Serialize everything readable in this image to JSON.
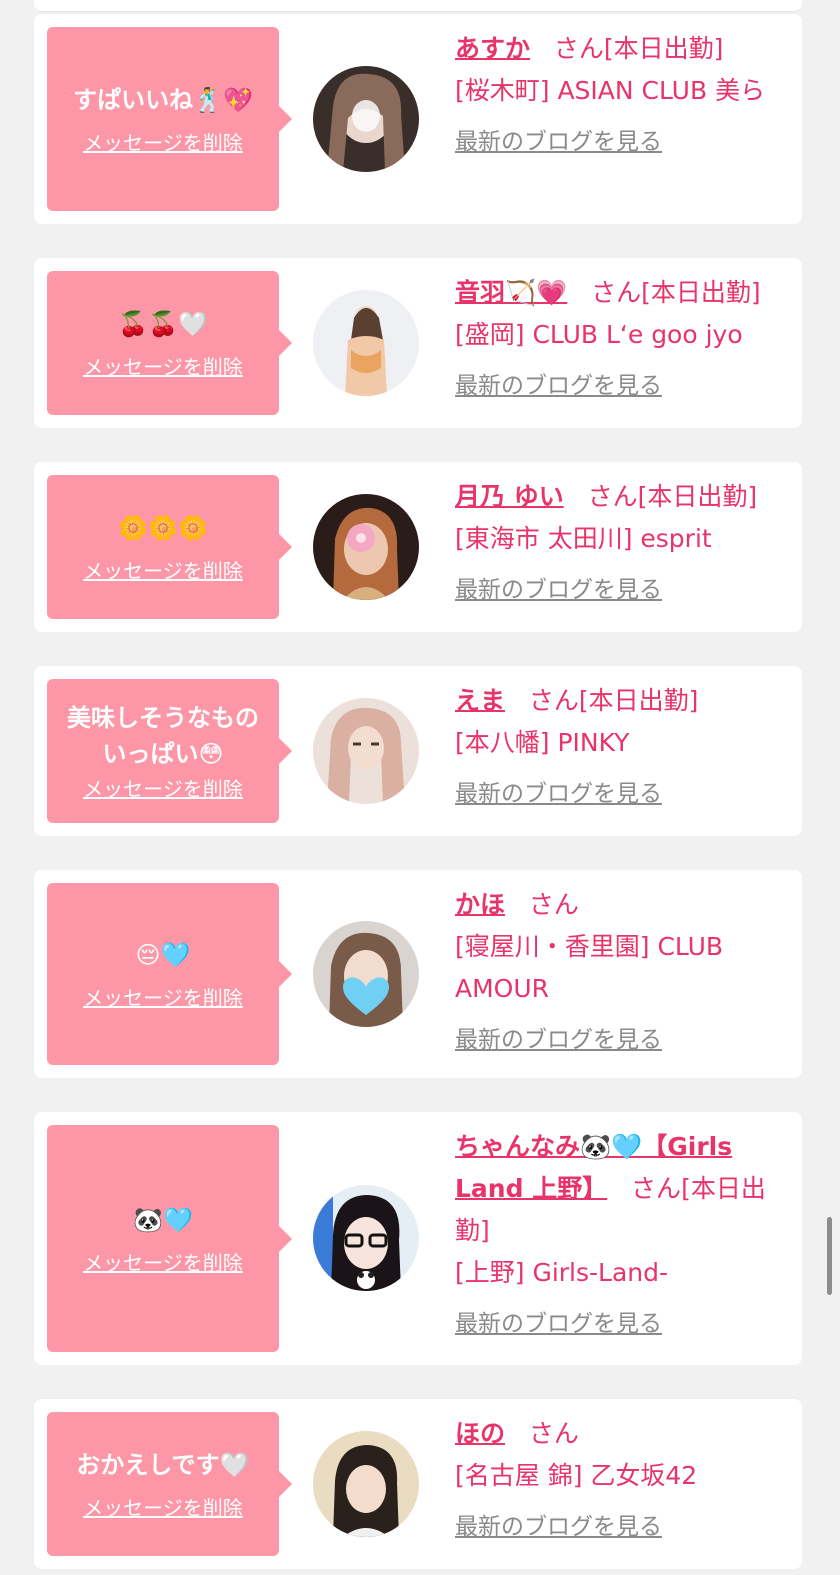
{
  "san_label": "さん",
  "delete_label": "メッセージを削除",
  "blog_label": "最新のブログを見る",
  "items": [
    {
      "message": "すぱいいね🕺💖",
      "name": "あすか",
      "status": "[本日出勤]",
      "shop": "[桜木町] ASIAN CLUB 美ら"
    },
    {
      "message": "🍒🍒🤍",
      "name": "音羽🏹💗",
      "status": "[本日出勤]",
      "shop": "[盛岡] CLUB L‘e goo jyo"
    },
    {
      "message": "🌼🌼🌼",
      "name": "月乃 ゆい",
      "status": "[本日出勤]",
      "shop": "[東海市 太田川] esprit"
    },
    {
      "message": "美味しそうなものいっぱい😳",
      "name": "えま",
      "status": "[本日出勤]",
      "shop": "[本八幡] PINKY"
    },
    {
      "message": "😔🩵",
      "name": "かほ",
      "status": "",
      "shop": "[寝屋川・香里園] CLUB AMOUR"
    },
    {
      "message": "🐼🩵",
      "name": "ちゃんなみ🐼🩵【Girls Land 上野】",
      "status": "[本日出勤]",
      "shop": "[上野] Girls-Land-"
    },
    {
      "message": "おかえしです🤍",
      "name": "ほの",
      "status": "",
      "shop": "[名古屋 錦] 乙女坂42"
    }
  ]
}
